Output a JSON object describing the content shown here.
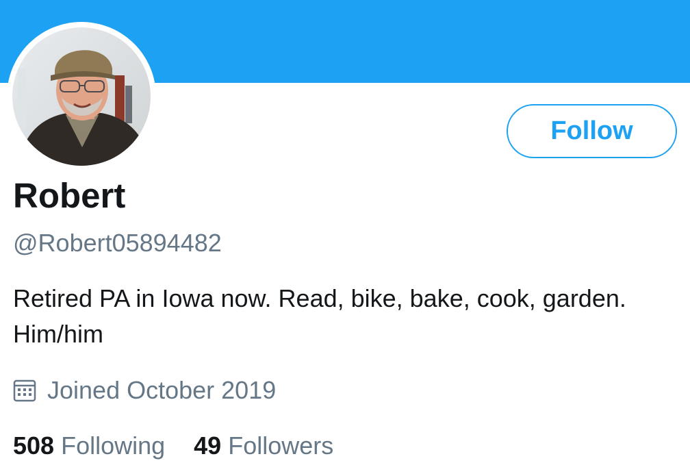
{
  "profile": {
    "name": "Robert",
    "handle": "@Robert05894482",
    "bio": "Retired PA in Iowa now. Read, bike, bake, cook, garden. Him/him",
    "joined": "Joined October 2019",
    "follow_label": "Follow"
  },
  "stats": {
    "following_count": "508",
    "following_label": "Following",
    "followers_count": "49",
    "followers_label": "Followers"
  },
  "icons": {
    "calendar": "calendar-icon"
  },
  "colors": {
    "accent": "#1da1f2",
    "primary_text": "#14171a",
    "secondary_text": "#657786",
    "background": "#ffffff"
  }
}
